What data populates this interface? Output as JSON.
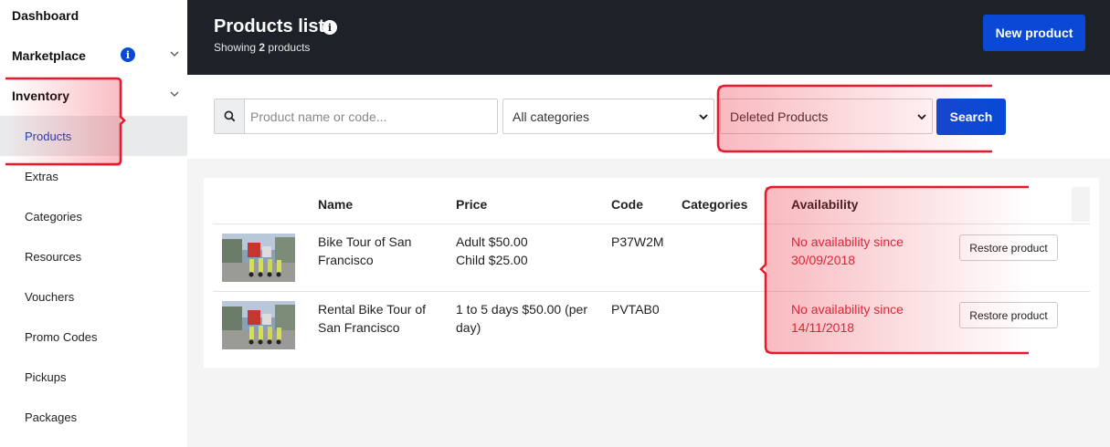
{
  "sidebar": {
    "items": [
      {
        "label": "Dashboard"
      },
      {
        "label": "Marketplace",
        "badge": "i"
      },
      {
        "label": "Inventory"
      },
      {
        "label": "Products"
      },
      {
        "label": "Extras"
      },
      {
        "label": "Categories"
      },
      {
        "label": "Resources"
      },
      {
        "label": "Vouchers"
      },
      {
        "label": "Promo Codes"
      },
      {
        "label": "Pickups"
      },
      {
        "label": "Packages"
      }
    ]
  },
  "header": {
    "title": "Products list",
    "title_info": "i",
    "subtitle_prefix": "Showing ",
    "subtitle_count": "2",
    "subtitle_suffix": " products",
    "new_button": "New product"
  },
  "filters": {
    "search_placeholder": "Product name or code...",
    "category_value": "All categories",
    "status_value": "Deleted Products",
    "search_button": "Search"
  },
  "table": {
    "columns": [
      "Name",
      "Price",
      "Code",
      "Categories",
      "Availability"
    ],
    "rows": [
      {
        "name": [
          "Bike Tour of San",
          "Francisco"
        ],
        "price": [
          "Adult $50.00",
          "Child $25.00"
        ],
        "code": "P37W2M",
        "availability": [
          "No availability since",
          "30/09/2018"
        ],
        "action": "Restore product"
      },
      {
        "name": [
          "Rental Bike Tour of",
          "San Francisco"
        ],
        "price": [
          "1 to 5 days $50.00 (per",
          "day)"
        ],
        "code": "PVTAB0",
        "availability": [
          "No availability since",
          "14/11/2018"
        ],
        "action": "Restore product"
      }
    ]
  },
  "colors": {
    "accent": "#0a49d6",
    "header_bg": "#1d2229",
    "danger": "#d8293a",
    "highlight": "#e8192c"
  }
}
